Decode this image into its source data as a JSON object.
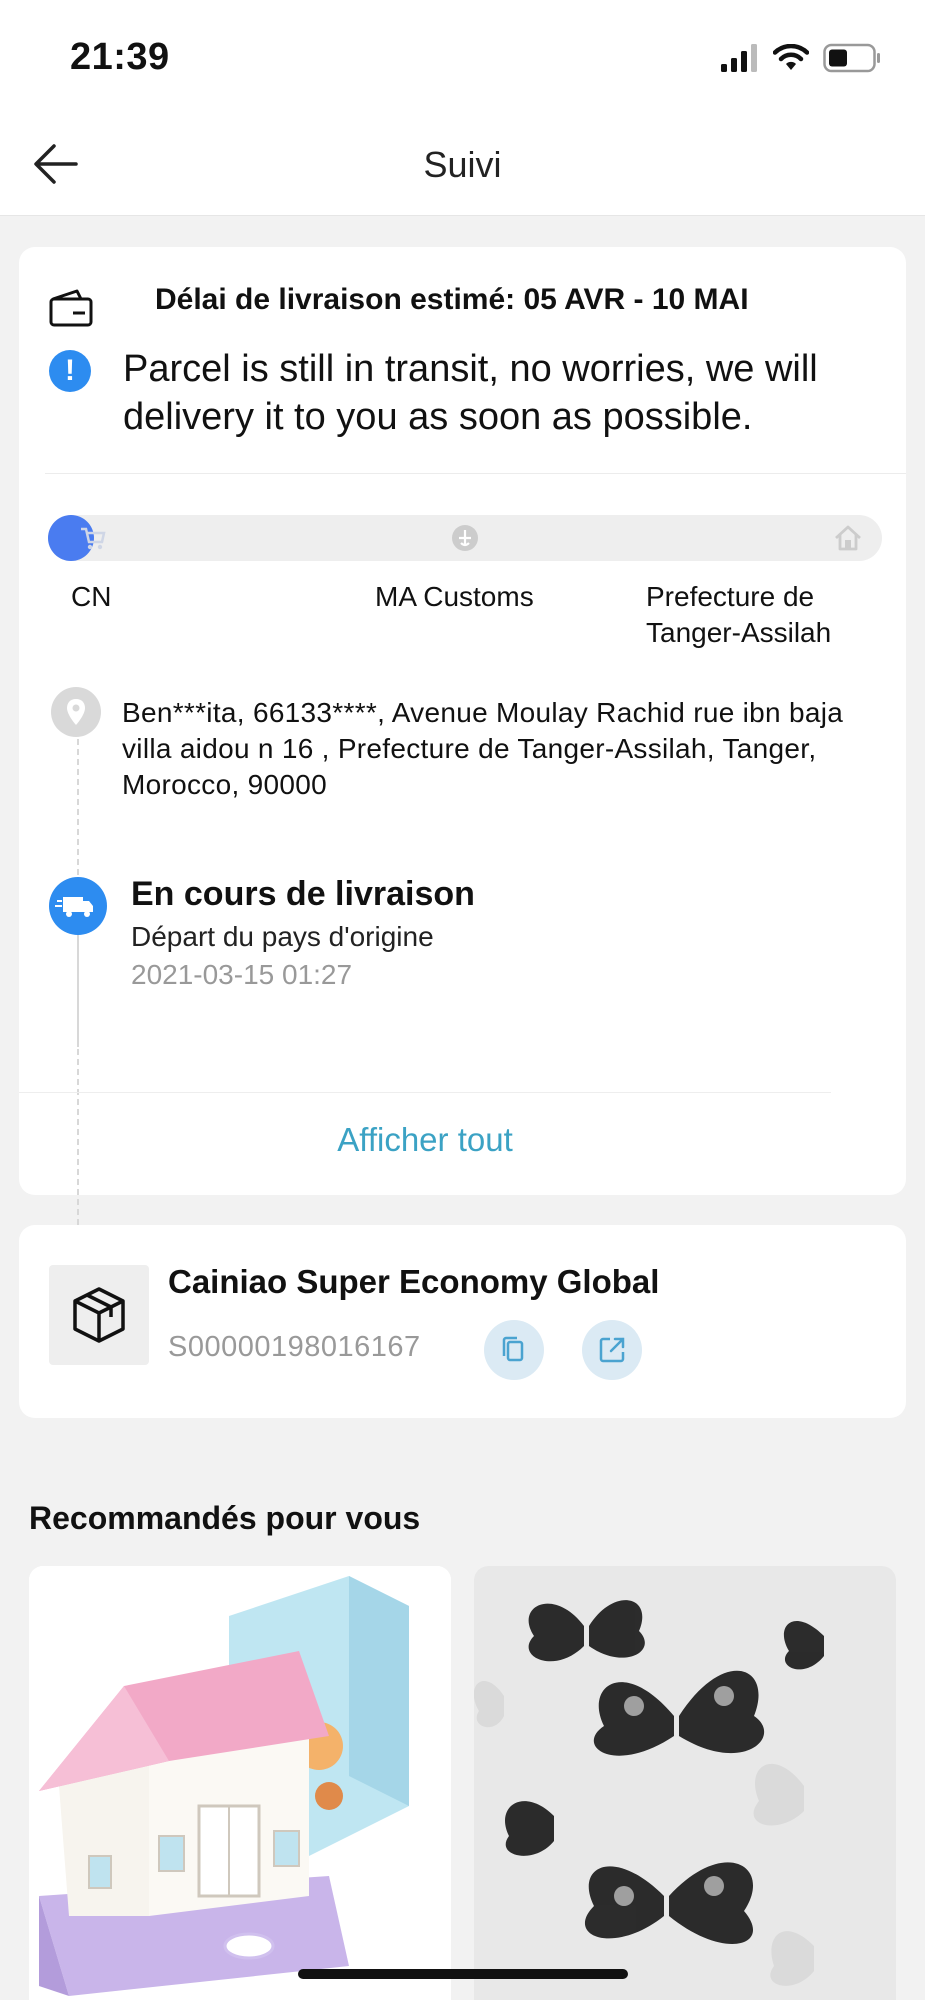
{
  "status_bar": {
    "time": "21:39"
  },
  "nav": {
    "title": "Suivi"
  },
  "tracking": {
    "eta_label": "Délai de livraison estimé: 05 AVR - 10 MAI",
    "transit_message": "Parcel is still in transit, no worries, we will delivery it to you as soon as possible.",
    "progress_fraction": 0.0,
    "stages": [
      {
        "label": "CN",
        "icon": "cart-icon"
      },
      {
        "label": "MA Customs",
        "icon": "customs-icon"
      },
      {
        "label": "Prefecture de Tanger-Assilah",
        "icon": "home-icon"
      }
    ],
    "address": "Ben***ita,  66133****,  Avenue Moulay Rachid rue ibn baja villa aidou n 16 ,  Prefecture de Tanger-Assilah,  Tanger,  Morocco,  90000",
    "event": {
      "title": "En cours de livraison",
      "description": "Départ du pays d'origine",
      "time": "2021-03-15 01:27"
    },
    "show_all": "Afficher tout"
  },
  "carrier": {
    "name": "Cainiao Super Economy Global",
    "tracking_number": "S00000198016167"
  },
  "recommendations": {
    "title": "Recommandés pour vous",
    "items": [
      {
        "image": "toy-house-money-box"
      },
      {
        "image": "butterfly-wall-stickers"
      }
    ]
  },
  "colors": {
    "accent_blue": "#2d8cf0",
    "link_teal": "#3ba2c4",
    "progress_blue": "#4a7cf0"
  }
}
